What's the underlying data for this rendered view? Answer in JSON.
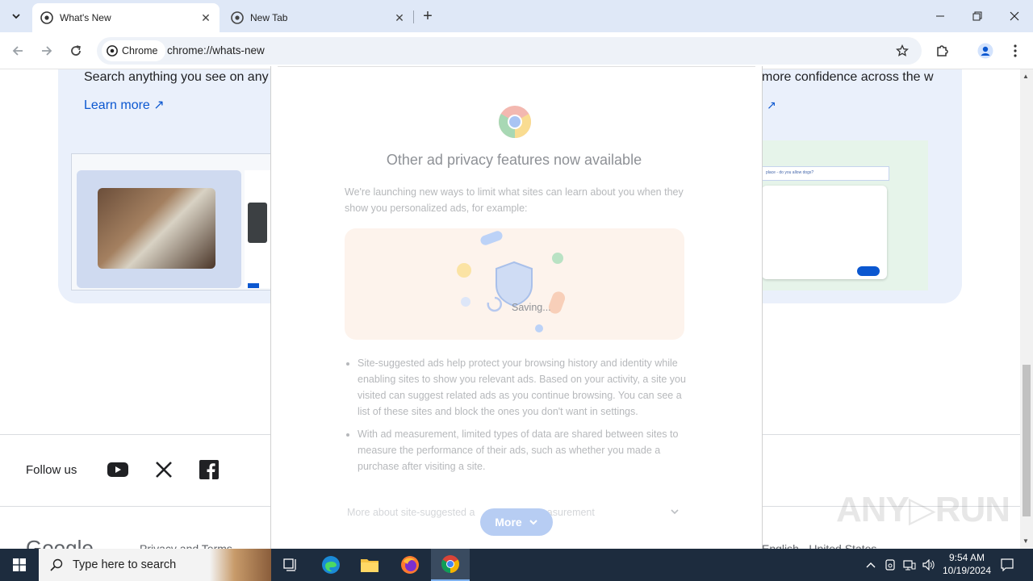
{
  "tabs": [
    {
      "label": "What's New",
      "active": true
    },
    {
      "label": "New Tab",
      "active": false
    }
  ],
  "toolbar": {
    "chip_label": "Chrome",
    "url": "chrome://whats-new"
  },
  "page": {
    "card_left_text": "Search anything you see on any",
    "card_right_text": "more confidence across the w",
    "learn_more": "Learn more ↗",
    "right_arrow": "↗",
    "shot_right_bar": "place - do you allow dogs?",
    "follow_us": "Follow us",
    "footer_brand": "Google",
    "footer_link": "Privacy and Terms",
    "footer_lang": "English - United States"
  },
  "modal": {
    "title": "Other ad privacy features now available",
    "description": "We're launching new ways to limit what sites can learn about you when they show you personalized ads, for example:",
    "saving": "Saving...",
    "bullets": [
      "Site-suggested ads help protect your browsing history and identity while enabling sites to show you relevant ads. Based on your activity, a site you visited can suggest related ads as you continue browsing. You can see a list of these sites and block the ones you don't want in settings.",
      "With ad measurement, limited types of data are shared between sites to measure the performance of their ads, such as whether you made a purchase after visiting a site."
    ],
    "more_about": "More about site-suggested a",
    "more_about_tail": "measurement",
    "more_button": "More"
  },
  "watermark": "ANY▷RUN",
  "taskbar": {
    "search_placeholder": "Type here to search",
    "time": "9:54 AM",
    "date": "10/19/2024"
  }
}
